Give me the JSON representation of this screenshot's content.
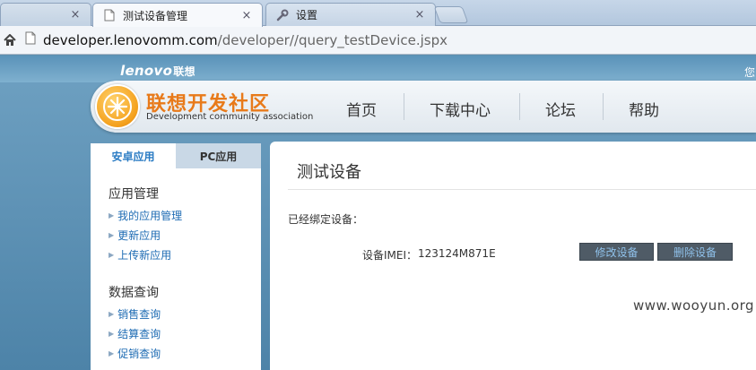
{
  "browser": {
    "tabs": [
      {
        "title": "",
        "close": "×"
      },
      {
        "title": "测试设备管理",
        "close": "×"
      },
      {
        "title": "设置",
        "close": "×"
      }
    ],
    "url_host": "developer.lenovomm.com",
    "url_path": "/developer//query_testDevice.jspx"
  },
  "header": {
    "brand": "lenovo",
    "brand_cn": "联想",
    "user_truncated": "您",
    "site_title": "联想开发社区",
    "site_subtitle": "Development community association",
    "nav": [
      "首页",
      "下载中心",
      "论坛",
      "帮助"
    ]
  },
  "sidebar": {
    "tabs": [
      "安卓应用",
      "PC应用"
    ],
    "groups": [
      {
        "title": "应用管理",
        "links": [
          "我的应用管理",
          "更新应用",
          "上传新应用"
        ]
      },
      {
        "title": "数据查询",
        "links": [
          "销售查询",
          "结算查询",
          "促销查询"
        ]
      }
    ]
  },
  "main": {
    "title": "测试设备",
    "bound_label": "已经绑定设备：",
    "imei_label": "设备IMEI：",
    "imei_value": "123124M871E",
    "edit_button": "修改设备",
    "delete_button": "删除设备"
  },
  "watermark": "www.wooyun.org",
  "colors": {
    "accent": "#2b7cc4",
    "site_title": "#e87a1a",
    "button_bg": "#4f5b66",
    "button_text": "#8fc1ea"
  }
}
